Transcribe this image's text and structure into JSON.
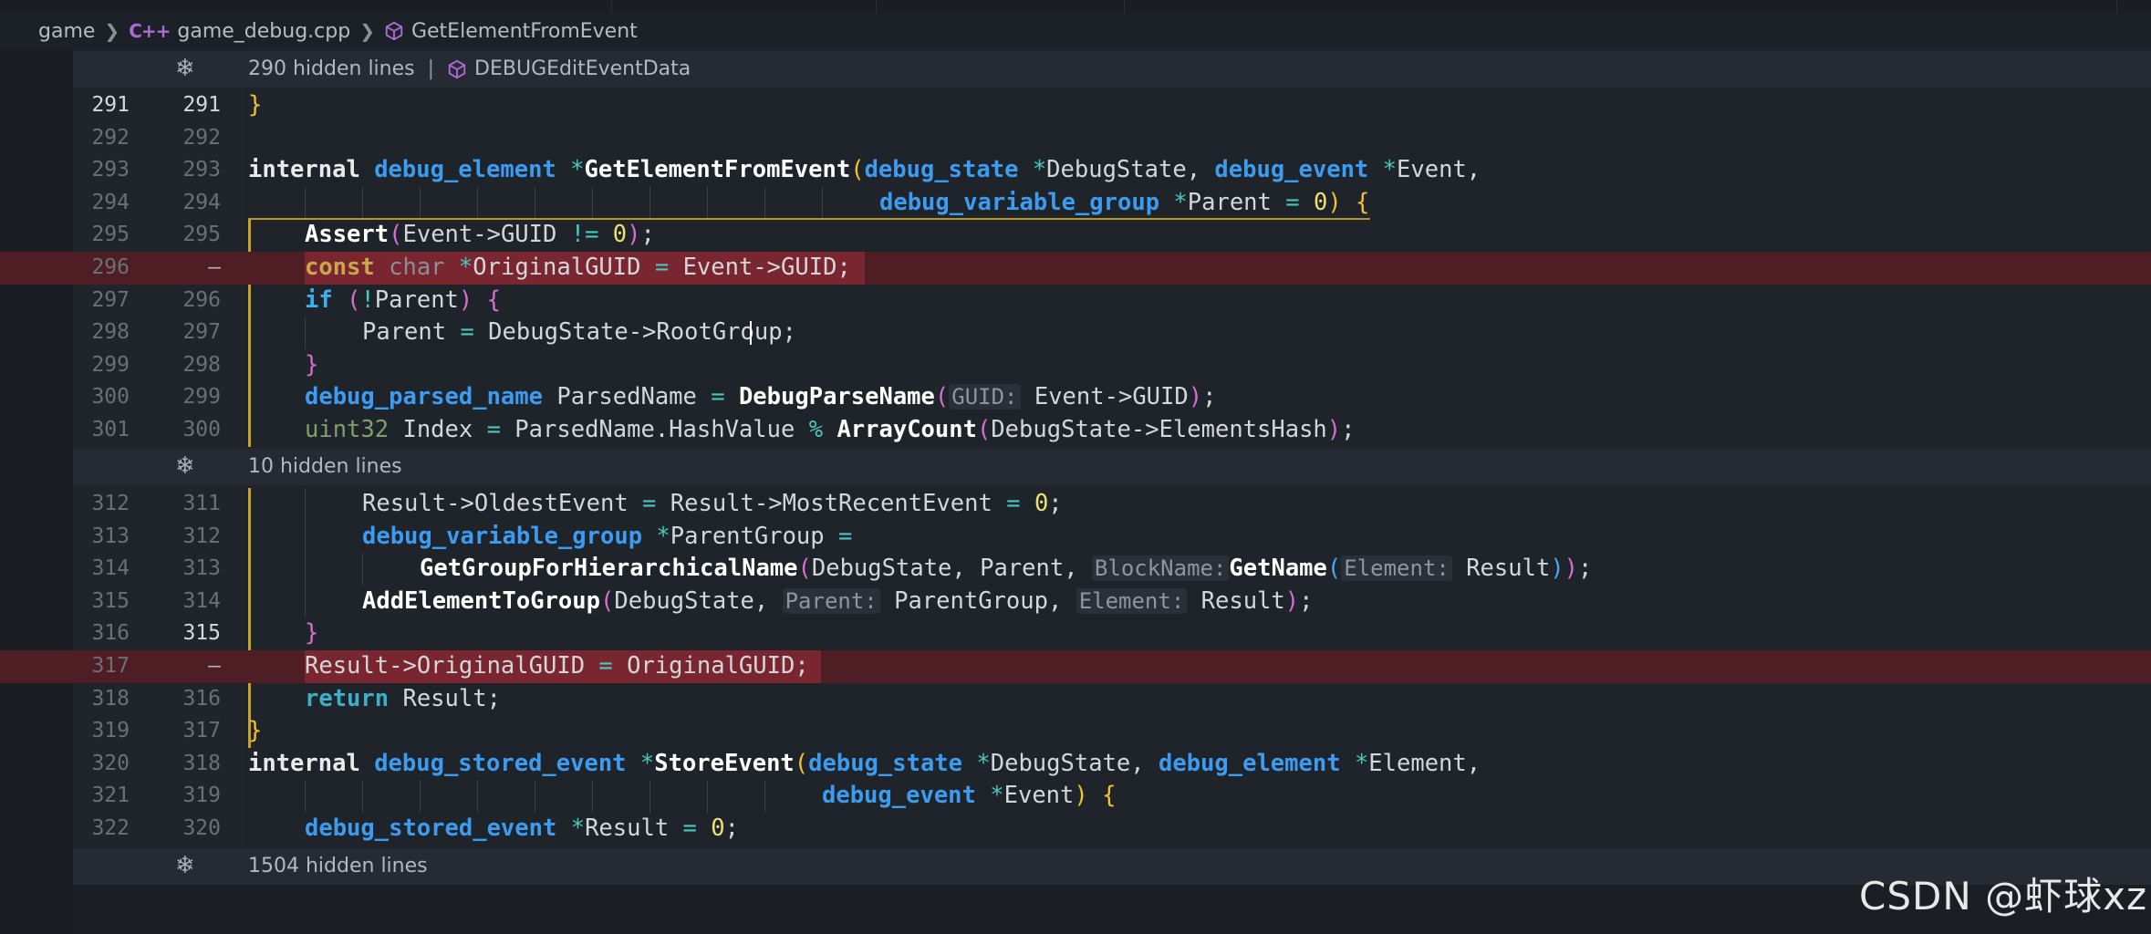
{
  "breadcrumb": {
    "folder": "game",
    "file_lang": "C++",
    "file": "game_debug.cpp",
    "symbol": "GetElementFromEvent"
  },
  "folds": {
    "top": {
      "label": "290 hidden lines",
      "separator": "|",
      "symbol": "DEBUGEditEventData"
    },
    "middle": {
      "label": "10 hidden lines"
    },
    "bottom": {
      "label": "1504 hidden lines"
    }
  },
  "line_numbers": {
    "l291": {
      "old": "291",
      "new": "291"
    },
    "l292": {
      "old": "292",
      "new": "292"
    },
    "l293": {
      "old": "293",
      "new": "293"
    },
    "l294": {
      "old": "294",
      "new": "294"
    },
    "l295": {
      "old": "295",
      "new": "295"
    },
    "l296": {
      "old": "296",
      "new": "—"
    },
    "l297": {
      "old": "297",
      "new": "296"
    },
    "l298": {
      "old": "298",
      "new": "297"
    },
    "l299": {
      "old": "299",
      "new": "298"
    },
    "l300": {
      "old": "300",
      "new": "299"
    },
    "l301": {
      "old": "301",
      "new": "300"
    },
    "l312": {
      "old": "312",
      "new": "311"
    },
    "l313": {
      "old": "313",
      "new": "312"
    },
    "l314": {
      "old": "314",
      "new": "313"
    },
    "l315": {
      "old": "315",
      "new": "314"
    },
    "l316": {
      "old": "316",
      "new": "315"
    },
    "l317": {
      "old": "317",
      "new": "—"
    },
    "l318": {
      "old": "318",
      "new": "316"
    },
    "l319": {
      "old": "319",
      "new": "317"
    },
    "l320": {
      "old": "320",
      "new": "318"
    },
    "l321": {
      "old": "321",
      "new": "319"
    },
    "l322": {
      "old": "322",
      "new": "320"
    }
  },
  "code": {
    "t": {
      "brace_close": "}",
      "internal": "internal",
      "debug_element": "debug_element",
      "star": "*",
      "GetElementFromEvent": "GetElementFromEvent",
      "paren_open": "(",
      "debug_state": "debug_state",
      "DebugState_comma": "DebugState, ",
      "debug_event": "debug_event",
      "Event_comma": "Event,",
      "debug_variable_group": "debug_variable_group",
      "Parent_eq": "Parent ",
      "eq": "=",
      "zero": "0",
      "paren_close": ")",
      "brace_open": "{",
      "Assert": "Assert",
      "EventGUID": "Event->GUID ",
      "neq": "!=",
      "semi": ";",
      "const": "const",
      "char": "char",
      "OriginalGUID_decl": "OriginalGUID ",
      "EventGUID2": " Event->GUID;",
      "if": "if",
      "bang": "!",
      "Parent": "Parent",
      "ParentAssign": "Parent ",
      "RootGroup": " DebugState->RootGroup;",
      "debug_parsed_name": "debug_parsed_name",
      "ParsedName_decl": " ParsedName ",
      "DebugParseName": "DebugParseName",
      "hint_GUID": "GUID:",
      "EventGUID3": " Event->GUID",
      "uint32": "uint32",
      "Index": " Index ",
      "ParsedHash": " ParsedName.HashValue ",
      "pct": "%",
      "ArrayCount": "ArrayCount",
      "ElementsHash": "DebugState->ElementsHash",
      "ResultOldest": "Result->OldestEvent ",
      "ResultMostRecent": " Result->MostRecentEvent ",
      "ParentGroup_decl": "ParentGroup ",
      "GetGroupFor": "GetGroupForHierarchicalName",
      "DS_Parent": "DebugState, Parent, ",
      "hint_BlockName": "BlockName:",
      "GetName": "GetName",
      "hint_Element": "Element:",
      "Result": " Result",
      "AddElementToGroup": "AddElementToGroup",
      "DS_comma": "DebugState, ",
      "hint_Parent": "Parent:",
      "ParentGroup_arg": " ParentGroup, ",
      "ResultOrig": "Result->OriginalGUID ",
      "OriginalGUID_val": " OriginalGUID;",
      "return": "return",
      "ResultSemi": " Result;",
      "debug_stored_event": "debug_stored_event",
      "StoreEvent": "StoreEvent",
      "Element_comma": "Element,",
      "Event_paren": "Event",
      "Result_decl": "Result ",
      "space": " "
    }
  },
  "watermark": "CSDN @虾球xz"
}
